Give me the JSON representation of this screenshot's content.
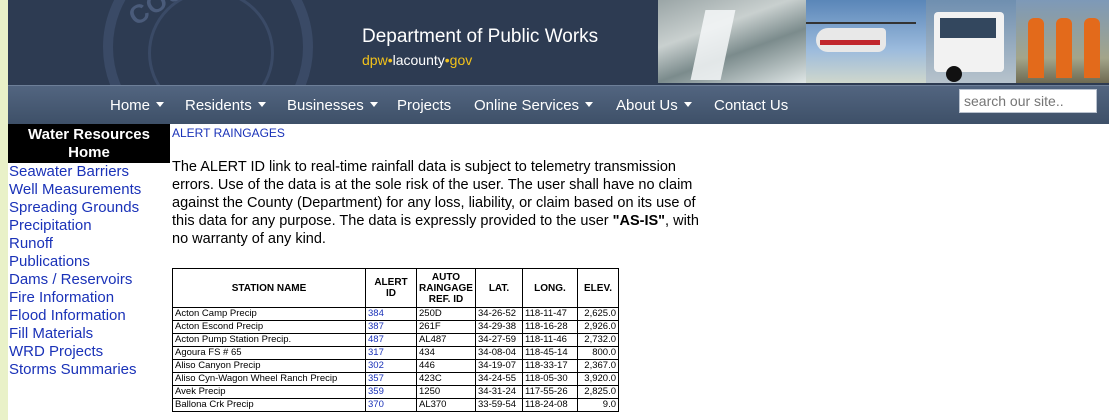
{
  "header": {
    "seal_text": "COUNTY OF LOS ANGELES",
    "title": "Department of Public Works",
    "url_prefix": "dpw",
    "url_dot1": "•",
    "url_mid": "lacounty",
    "url_dot2": "•",
    "url_suffix": "gov"
  },
  "nav": {
    "items": [
      {
        "label": "Home",
        "caret": true
      },
      {
        "label": "Residents",
        "caret": true
      },
      {
        "label": "Businesses",
        "caret": true
      },
      {
        "label": "Projects",
        "caret": false
      },
      {
        "label": "Online Services",
        "caret": true
      },
      {
        "label": "About Us",
        "caret": true
      },
      {
        "label": "Contact Us",
        "caret": false
      }
    ],
    "search_placeholder": "search our site.."
  },
  "sidebar": {
    "title": "Water Resources Home",
    "links": [
      "Seawater Barriers",
      "Well Measurements",
      "Spreading Grounds",
      "Precipitation",
      "Runoff",
      "Publications",
      "Dams / Reservoirs",
      "Fire Information",
      "Flood Information",
      "Fill Materials",
      "WRD Projects",
      "Storms Summaries"
    ]
  },
  "content": {
    "heading": "ALERT RAINGAGES",
    "disclaimer_before": "The ALERT ID link to real-time rainfall data is subject to telemetry transmission errors. Use of the data is at the sole risk of the user. The user shall have no claim against the County (Department) for any loss, liability, or claim based on its use of this data for any purpose. The data is expressly provided to the user ",
    "disclaimer_bold": "\"AS-IS\"",
    "disclaimer_after": ", with no warranty of any kind."
  },
  "table": {
    "headers": {
      "station": "STATION NAME",
      "alert": "ALERT ID",
      "auto_line1": "AUTO",
      "auto_line2": "RAINGAGE",
      "auto_line3": "REF. ID",
      "lat": "LAT.",
      "long": "LONG.",
      "elev": "ELEV."
    },
    "rows": [
      {
        "station": "Acton Camp Precip",
        "alert": "384",
        "auto": "250D",
        "lat": "34-26-52",
        "long": "118-11-47",
        "elev": "2,625.0"
      },
      {
        "station": "Acton Escond Precip",
        "alert": "387",
        "auto": "261F",
        "lat": "34-29-38",
        "long": "118-16-28",
        "elev": "2,926.0"
      },
      {
        "station": "Acton Pump Station Precip.",
        "alert": "487",
        "auto": "AL487",
        "lat": "34-27-59",
        "long": "118-11-46",
        "elev": "2,732.0"
      },
      {
        "station": "Agoura FS # 65",
        "alert": "317",
        "auto": "434",
        "lat": "34-08-04",
        "long": "118-45-14",
        "elev": "800.0"
      },
      {
        "station": "Aliso Canyon Precip",
        "alert": "302",
        "auto": "446",
        "lat": "34-19-07",
        "long": "118-33-17",
        "elev": "2,367.0"
      },
      {
        "station": "Aliso Cyn-Wagon Wheel Ranch Precip",
        "alert": "357",
        "auto": "423C",
        "lat": "34-24-55",
        "long": "118-05-30",
        "elev": "3,920.0"
      },
      {
        "station": "Avek Precip",
        "alert": "359",
        "auto": "1250",
        "lat": "34-31-24",
        "long": "117-55-26",
        "elev": "2,825.0"
      },
      {
        "station": "Ballona Crk Precip",
        "alert": "370",
        "auto": "AL370",
        "lat": "33-59-54",
        "long": "118-24-08",
        "elev": "9.0"
      }
    ]
  }
}
